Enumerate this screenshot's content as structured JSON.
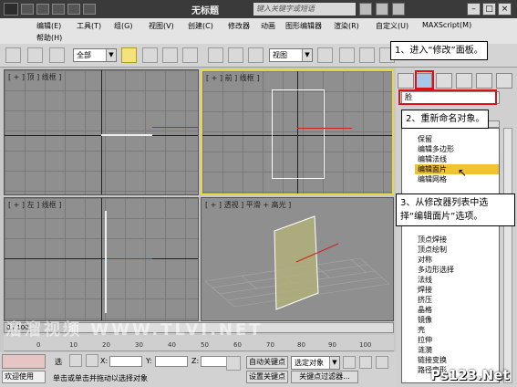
{
  "window": {
    "title": "无标题",
    "search_placeholder": "键入关键字或短语"
  },
  "menu": {
    "row1": [
      "编辑(E)",
      "工具(T)",
      "组(G)",
      "视图(V)",
      "创建(C)",
      "修改器",
      "动画",
      "图形编辑器",
      "渲染(R)",
      "自定义(U)",
      "MAXScript(M)"
    ],
    "row2": [
      "帮助(H)"
    ]
  },
  "toolbar": {
    "filter_select": "全部",
    "view_select": "视图"
  },
  "viewports": {
    "top": "[ + ] 顶 ] 线框 ]",
    "front": "[ + ] 前 ] 线框 ]",
    "left": "[ + ] 左 ] 线框 ]",
    "perspective": "[ + ] 透视 ] 平滑 + 高光 ]"
  },
  "command_panel": {
    "name_value": "脸",
    "modifiers": [
      "保留",
      "编辑多边形",
      "编辑法线",
      "编辑面片",
      "编辑网格",
      "顶点焊接",
      "顶点绘制",
      "对称",
      "多边形选择",
      "法线",
      "焊接",
      "挤压",
      "晶格",
      "镜像",
      "壳",
      "拉伸",
      "涟漪",
      "链接变换",
      "路径变形"
    ],
    "selected_modifier": "编辑面片"
  },
  "callouts": {
    "step1": "1、进入“修改”面板。",
    "step2": "2、重新命名对象。",
    "step3_line1": "3、从修改器列表中选",
    "step3_line2": "择“编辑面片”选项。"
  },
  "timeline": {
    "position": "0 / 100",
    "ticks": [
      "0",
      "10",
      "20",
      "30",
      "40",
      "50",
      "60",
      "70",
      "80",
      "90",
      "100"
    ]
  },
  "status": {
    "welcome": "欢迎使用",
    "message": "单击或单击并拖动以选择对象",
    "select_label": "选",
    "x_label": "X:",
    "y_label": "Y:",
    "z_label": "Z:",
    "auto_key": "自动关键点",
    "set_key": "设置关键点",
    "selected_object": "选定对象",
    "key_filter": "关键点过滤器..."
  },
  "watermarks": {
    "left": "溜溜视频 WWW.TLVI.NET",
    "right": "Ps123.Net"
  },
  "colors": {
    "highlight": "#f1c232",
    "callout_border": "#d11111",
    "active_viewport": "#e6d84b"
  }
}
